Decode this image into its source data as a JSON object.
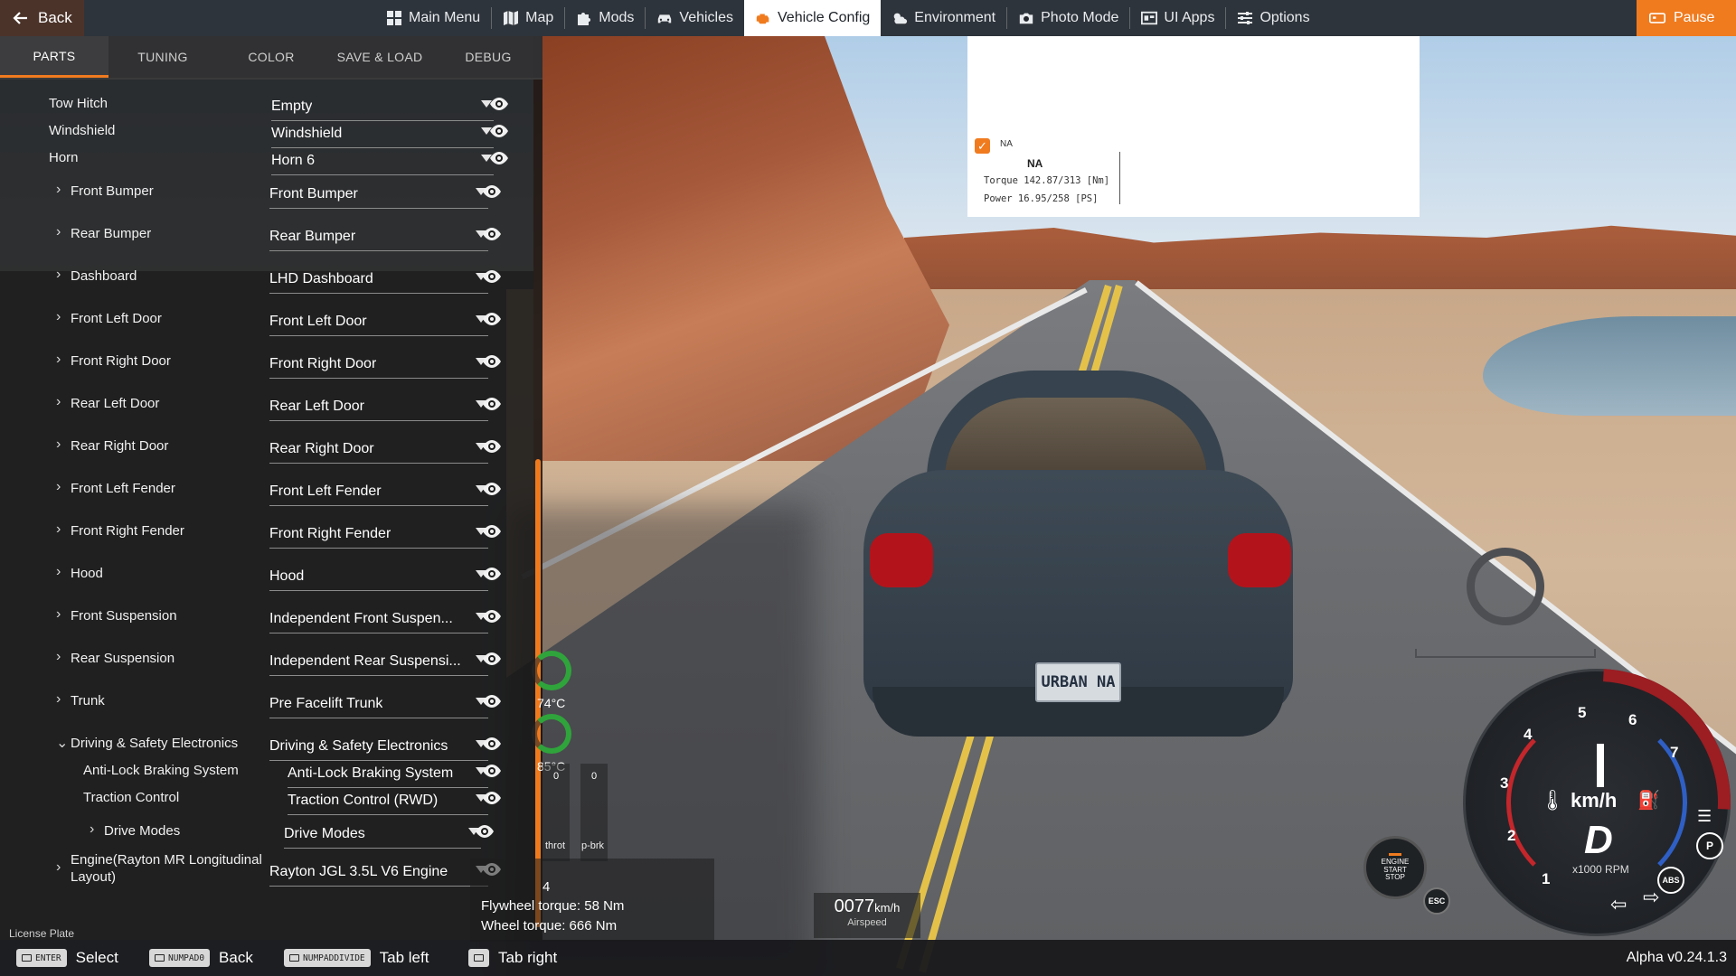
{
  "topbar": {
    "back_label": "Back",
    "nav": [
      {
        "label": "Main Menu",
        "icon": "grid-icon"
      },
      {
        "label": "Map",
        "icon": "map-icon"
      },
      {
        "label": "Mods",
        "icon": "puzzle-icon"
      },
      {
        "label": "Vehicles",
        "icon": "car-icon"
      },
      {
        "label": "Vehicle Config",
        "icon": "engine-icon",
        "active": true
      },
      {
        "label": "Environment",
        "icon": "weather-icon"
      },
      {
        "label": "Photo Mode",
        "icon": "camera-icon"
      },
      {
        "label": "UI Apps",
        "icon": "ui-apps-icon"
      },
      {
        "label": "Options",
        "icon": "sliders-icon"
      }
    ],
    "pause_label": "Pause",
    "accent_color": "#f07b1f"
  },
  "panel": {
    "tabs": [
      "PARTS",
      "TUNING",
      "COLOR",
      "SAVE & LOAD",
      "DEBUG"
    ],
    "active_tab": "PARTS",
    "rows": [
      {
        "label": "Tow Hitch",
        "value": "Empty"
      },
      {
        "label": "Windshield",
        "value": "Windshield"
      },
      {
        "label": "Horn",
        "value": "Horn 6"
      },
      {
        "label": "Front Bumper",
        "value": "Front Bumper"
      },
      {
        "label": "Rear Bumper",
        "value": "Rear Bumper"
      },
      {
        "label": "Dashboard",
        "value": "LHD Dashboard"
      },
      {
        "label": "Front Left Door",
        "value": "Front Left Door"
      },
      {
        "label": "Front Right Door",
        "value": "Front Right Door"
      },
      {
        "label": "Rear Left Door",
        "value": "Rear Left Door"
      },
      {
        "label": "Rear Right Door",
        "value": "Rear Right Door"
      },
      {
        "label": "Front Left Fender",
        "value": "Front Left Fender"
      },
      {
        "label": "Front Right Fender",
        "value": "Front Right Fender"
      },
      {
        "label": "Hood",
        "value": "Hood"
      },
      {
        "label": "Front Suspension",
        "value": "Independent Front Suspen..."
      },
      {
        "label": "Rear Suspension",
        "value": "Independent Rear Suspensi..."
      },
      {
        "label": "Trunk",
        "value": "Pre Facelift Trunk"
      },
      {
        "label": "Driving & Safety Electronics",
        "value": "Driving & Safety Electronics"
      },
      {
        "label": "Anti-Lock Braking System",
        "value": "Anti-Lock Braking System"
      },
      {
        "label": "Traction Control",
        "value": "Traction Control (RWD)"
      },
      {
        "label": "Drive Modes",
        "value": "Drive Modes"
      },
      {
        "label": "Engine(Rayton MR Longitudinal Layout)",
        "value": "Rayton JGL 3.5L V6 Engine"
      }
    ],
    "license_label": "License Plate"
  },
  "tooltip": {
    "check_label": "NA",
    "title": "NA",
    "torque": "Torque 142.87/313 [Nm]",
    "power": "Power  16.95/258  [PS]"
  },
  "hud": {
    "flywheel_torque": "Flywheel torque: 58 Nm",
    "wheel_torque": "Wheel torque: 666 Nm",
    "gear_row": "4",
    "temp1": "74°C",
    "temp2": "85°C",
    "throttle_label": "throt",
    "pbrake_label": "p-brk",
    "throttle_val": "0",
    "pbrake_val": "0",
    "airspeed_value": "0077",
    "airspeed_unit": "km/h",
    "airspeed_label": "Airspeed",
    "speedo_ticks": [
      "1",
      "2",
      "3",
      "4",
      "5",
      "6",
      "7"
    ],
    "speedo_unit": "km/h",
    "speedo_gear": "D",
    "speedo_rpm": "x1000 RPM",
    "parking_badge": "P",
    "abs_badge": "ABS",
    "engine_btn": "ENGINE START STOP",
    "esc_badge": "ESC",
    "plate": "URBAN NA"
  },
  "bottombar": {
    "hints": [
      {
        "key": "ENTER",
        "label": "Select"
      },
      {
        "key": "NUMPAD0",
        "label": "Back"
      },
      {
        "key": "NUMPADDIVIDE",
        "label": "Tab left"
      },
      {
        "key": "",
        "label": "Tab right"
      }
    ],
    "version": "Alpha v0.24.1.3"
  }
}
